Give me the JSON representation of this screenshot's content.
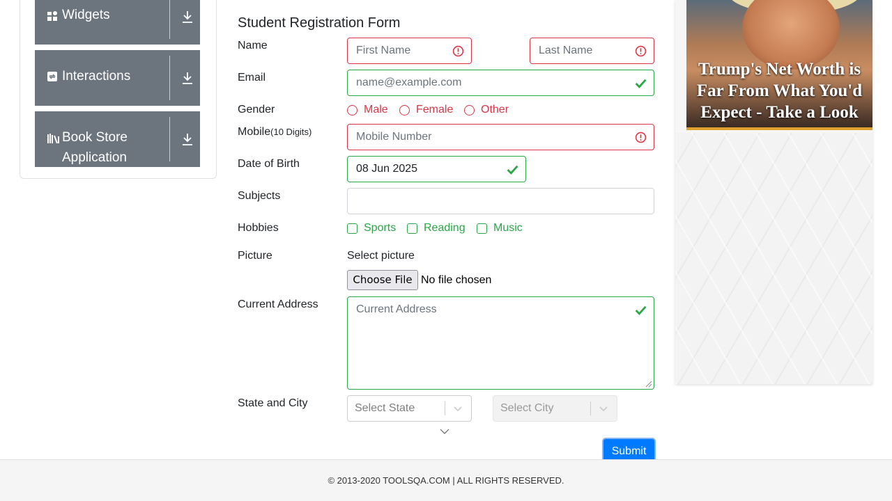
{
  "sidebar": {
    "groups": [
      {
        "label": "Widgets",
        "icon": "widgets-icon"
      },
      {
        "label": "Interactions",
        "icon": "interactions-icon"
      },
      {
        "label": "Book Store Application",
        "icon": "book-store-icon"
      }
    ]
  },
  "form": {
    "title": "Student Registration Form",
    "labels": {
      "name": "Name",
      "email": "Email",
      "gender": "Gender",
      "mobile": "Mobile",
      "mobile_hint": "(10 Digits)",
      "dob": "Date of Birth",
      "subjects": "Subjects",
      "hobbies": "Hobbies",
      "picture": "Picture",
      "address": "Current Address",
      "state_city": "State and City"
    },
    "first_name": {
      "placeholder": "First Name",
      "value": ""
    },
    "last_name": {
      "placeholder": "Last Name",
      "value": ""
    },
    "email": {
      "placeholder": "name@example.com",
      "value": ""
    },
    "genders": [
      "Male",
      "Female",
      "Other"
    ],
    "mobile": {
      "placeholder": "Mobile Number",
      "value": ""
    },
    "dob": {
      "value": "08 Jun 2025"
    },
    "subjects": {
      "value": ""
    },
    "hobbies": [
      "Sports",
      "Reading",
      "Music"
    ],
    "picture": {
      "select_label": "Select picture",
      "button": "Choose File",
      "status": "No file chosen"
    },
    "address": {
      "placeholder": "Current Address",
      "value": ""
    },
    "state": {
      "placeholder": "Select State"
    },
    "city": {
      "placeholder": "Select City"
    },
    "submit": "Submit"
  },
  "ad": {
    "headline": "Trump's Net Worth is Far From What You'd Expect - Take a Look"
  },
  "footer": {
    "text": "© 2013-2020 TOOLSQA.COM | ALL RIGHTS RESERVED."
  },
  "colors": {
    "invalid": "#dc3545",
    "valid": "#28a745",
    "primary": "#007bff",
    "sidebar_group": "#6c757d"
  }
}
